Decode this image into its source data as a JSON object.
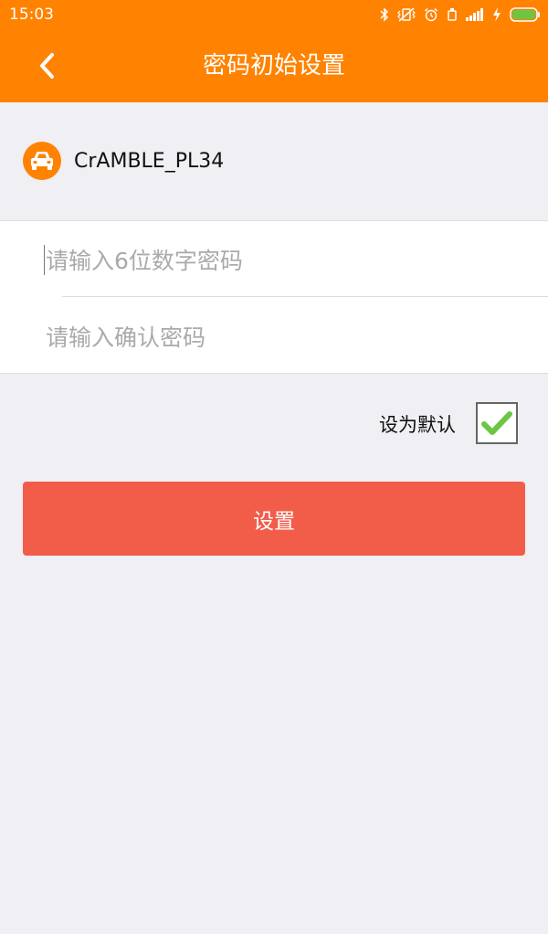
{
  "status_bar": {
    "time": "15:03",
    "icons": [
      "bluetooth-icon",
      "vibrate-icon",
      "alarm-icon",
      "battery-saver-icon",
      "signal-icon",
      "charging-icon",
      "battery-icon"
    ]
  },
  "header": {
    "title": "密码初始设置",
    "back_icon": "chevron-left-icon"
  },
  "device": {
    "icon": "car-icon",
    "name": "CrAMBLE_PL34"
  },
  "form": {
    "password_placeholder": "请输入6位数字密码",
    "password_value": "",
    "confirm_placeholder": "请输入确认密码",
    "confirm_value": "",
    "default_label": "设为默认",
    "default_checked": true
  },
  "submit": {
    "label": "设置"
  },
  "colors": {
    "brand": "#ff8200",
    "submit": "#f25d4a",
    "check": "#6cc644",
    "background": "#efeff4"
  }
}
